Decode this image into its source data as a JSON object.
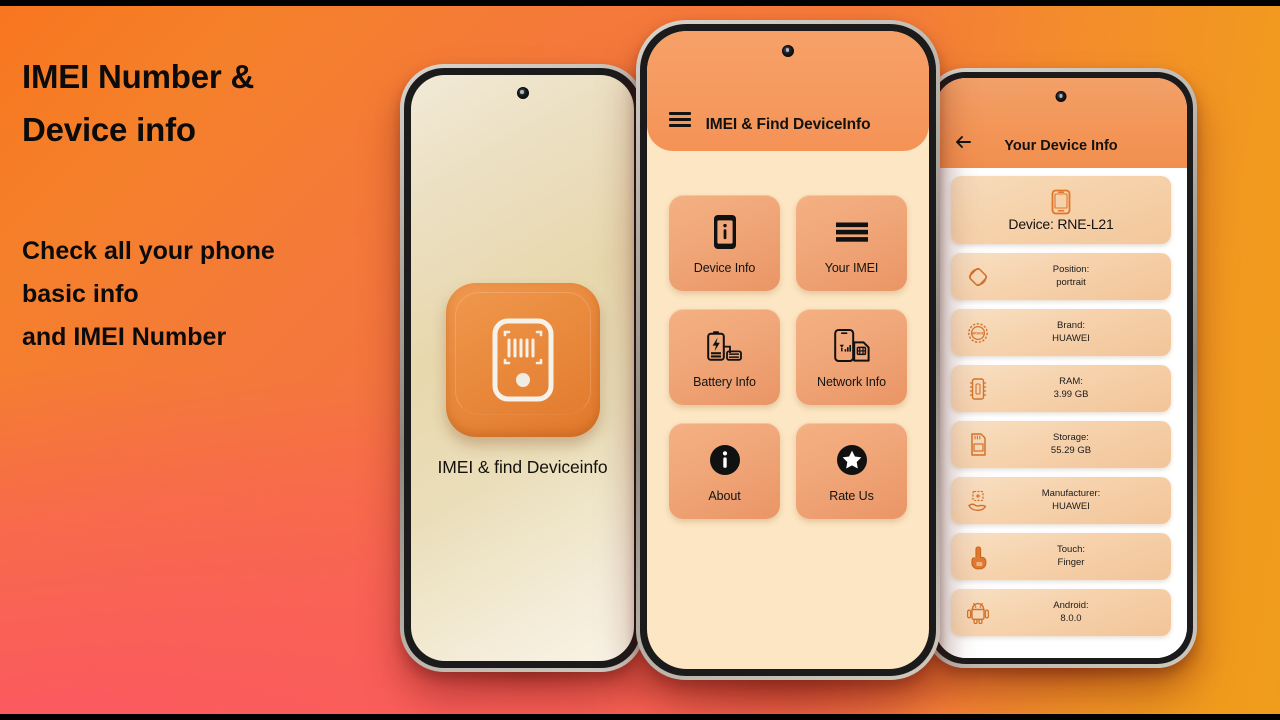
{
  "promo": {
    "headline": "IMEI Number &\nDevice info",
    "subheadline": "Check all your phone\n basic info\nand IMEI Number",
    "bg_gradient_start": "#f8761f",
    "bg_gradient_end": "#fc5a61",
    "bg_accent_right": "#f09c1b",
    "text_color": "#0b0b0b"
  },
  "left_phone": {
    "screen_tint": "#e8d8ae",
    "app_icon_color": "#ea8c3f",
    "app_icon_name": "phone-barcode-icon",
    "app_label": "IMEI & find Deviceinfo",
    "camera_icon": "front-camera-icon"
  },
  "center_phone": {
    "appbar_color": "#f59a5f",
    "screen_color": "#fce6c3",
    "menu_icon": "hamburger-menu-icon",
    "title": "IMEI & Find DeviceInfo",
    "camera_icon": "front-camera-icon",
    "card_color": "#f0a678",
    "tiles": [
      {
        "label": "Device Info",
        "icon": "phone-info-icon"
      },
      {
        "label": "Your IMEI",
        "icon": "barcode-lines-icon"
      },
      {
        "label": "Battery Info",
        "icon": "battery-charging-icon"
      },
      {
        "label": "Network Info",
        "icon": "phone-signal-sim-icon"
      },
      {
        "label": "About",
        "icon": "info-circle-icon"
      },
      {
        "label": "Rate Us",
        "icon": "star-circle-icon"
      }
    ]
  },
  "right_phone": {
    "appbar_color": "#f39658",
    "list_bg": "#ffffff",
    "row_color": "#f6d2ac",
    "back_icon": "arrow-left-icon",
    "title": "Your Device Info",
    "camera_icon": "front-camera-icon",
    "hero": {
      "icon": "smartphone-outline-icon",
      "text": "Device: RNE-L21"
    },
    "rows": [
      {
        "key": "Position:",
        "value": "portrait",
        "icon": "rotate-orientation-icon"
      },
      {
        "key": "Brand:",
        "value": "HUAWEI",
        "icon": "brand-badge-icon"
      },
      {
        "key": "RAM:",
        "value": "3.99 GB",
        "icon": "memory-chip-icon"
      },
      {
        "key": "Storage:",
        "value": "55.29 GB",
        "icon": "sd-card-icon"
      },
      {
        "key": "Manufacturer:",
        "value": "HUAWEI",
        "icon": "hand-factory-icon"
      },
      {
        "key": "Touch:",
        "value": "Finger",
        "icon": "touch-finger-icon"
      },
      {
        "key": "Android:",
        "value": "8.0.0",
        "icon": "android-robot-icon"
      }
    ]
  }
}
